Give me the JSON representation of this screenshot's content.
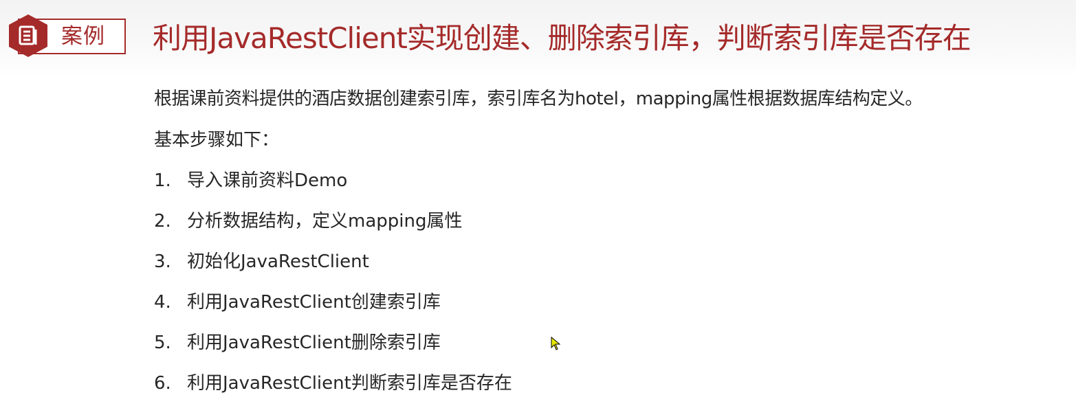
{
  "badge": {
    "label": "案例",
    "icon": "document-icon"
  },
  "title": "利用JavaRestClient实现创建、删除索引库，判断索引库是否存在",
  "intro": "根据课前资料提供的酒店数据创建索引库，索引库名为hotel，mapping属性根据数据库结构定义。",
  "steps_label": "基本步骤如下：",
  "steps": [
    {
      "num": "1.",
      "text": "导入课前资料Demo"
    },
    {
      "num": "2.",
      "text": "分析数据结构，定义mapping属性"
    },
    {
      "num": "3.",
      "text": "初始化JavaRestClient"
    },
    {
      "num": "4.",
      "text": "利用JavaRestClient创建索引库"
    },
    {
      "num": "5.",
      "text": "利用JavaRestClient删除索引库"
    },
    {
      "num": "6.",
      "text": "利用JavaRestClient判断索引库是否存在"
    }
  ],
  "colors": {
    "accent": "#a52a2a",
    "text": "#262626",
    "cursor": "#e8e800"
  }
}
